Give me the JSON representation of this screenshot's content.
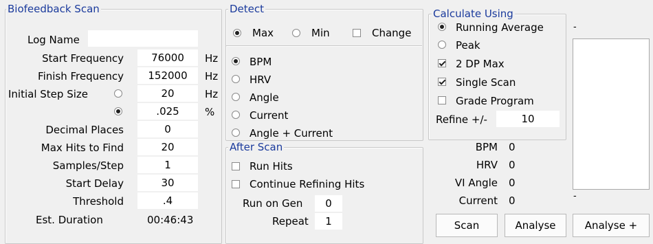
{
  "biofeedback": {
    "title": "Biofeedback Scan",
    "log_name_label": "Log Name",
    "log_name_value": "",
    "start_freq_label": "Start Frequency",
    "start_freq_value": "76000",
    "finish_freq_label": "Finish Frequency",
    "finish_freq_value": "152000",
    "unit_hz": "Hz",
    "unit_pct": "%",
    "step_size_label": "Initial Step Size",
    "step_hz_value": "20",
    "step_pct_value": ".025",
    "step_mode": "percent",
    "decimal_places_label": "Decimal Places",
    "decimal_places_value": "0",
    "max_hits_label": "Max Hits to Find",
    "max_hits_value": "20",
    "samples_label": "Samples/Step",
    "samples_value": "1",
    "start_delay_label": "Start Delay",
    "start_delay_value": "30",
    "threshold_label": "Threshold",
    "threshold_value": ".4",
    "est_duration_label": "Est. Duration",
    "est_duration_value": "00:46:43"
  },
  "detect": {
    "title": "Detect",
    "max_label": "Max",
    "min_label": "Min",
    "change_label": "Change",
    "bpm_label": "BPM",
    "hrv_label": "HRV",
    "angle_label": "Angle",
    "current_label": "Current",
    "angle_current_label": "Angle + Current"
  },
  "after_scan": {
    "title": "After Scan",
    "run_hits_label": "Run Hits",
    "continue_label": "Continue Refining Hits",
    "run_on_gen_label": "Run on Gen",
    "run_on_gen_value": "0",
    "repeat_label": "Repeat",
    "repeat_value": "1"
  },
  "calculate": {
    "title": "Calculate Using",
    "running_avg_label": "Running Average",
    "peak_label": "Peak",
    "dp_max_label": "2 DP Max",
    "single_scan_label": "Single Scan",
    "grade_program_label": "Grade Program",
    "refine_label": "Refine +/-",
    "refine_value": "10"
  },
  "readouts": {
    "bpm_label": "BPM",
    "bpm_value": "0",
    "hrv_label": "HRV",
    "hrv_value": "0",
    "vi_angle_label": "VI Angle",
    "vi_angle_value": "0",
    "current_label": "Current",
    "current_value": "0"
  },
  "buttons": {
    "scan": "Scan",
    "analyse": "Analyse",
    "analyse_plus": "Analyse +"
  },
  "listbox": {
    "top_marker": "-",
    "bottom_marker": "-"
  }
}
